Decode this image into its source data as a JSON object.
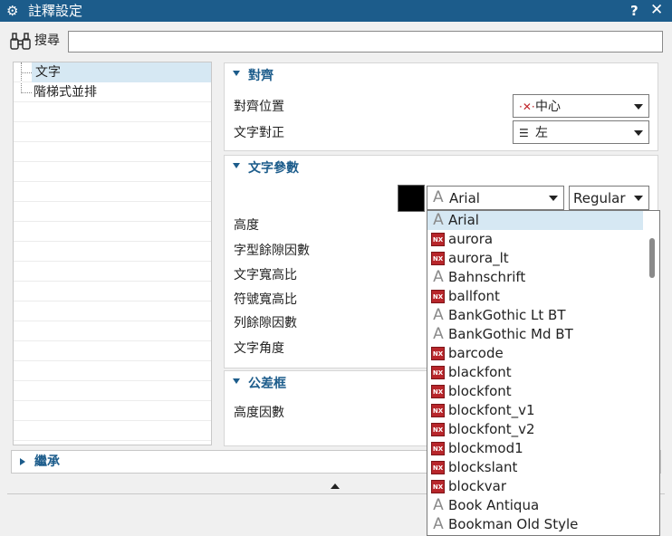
{
  "window": {
    "title": "註釋設定",
    "help_label": "?",
    "close_label": "✕"
  },
  "search": {
    "label": "搜尋",
    "value": ""
  },
  "tree": {
    "items": [
      {
        "label": "文字"
      },
      {
        "label": "階梯式並排"
      }
    ]
  },
  "alignment": {
    "title": "對齊",
    "position_label": "對齊位置",
    "position_value": "中心",
    "justify_label": "文字對正",
    "justify_value": "左"
  },
  "text_params": {
    "title": "文字參數",
    "font_value": "Arial",
    "style_value": "Regular",
    "fields": [
      "高度",
      "字型餘隙因數",
      "文字寬高比",
      "符號寬高比",
      "列餘隙因數",
      "文字角度"
    ]
  },
  "tolerance_frame": {
    "title": "公差框",
    "height_factor_label": "高度因數"
  },
  "inherit": {
    "label": "繼承"
  },
  "font_list": [
    {
      "name": "Arial",
      "icon": "truetype-icon"
    },
    {
      "name": "aurora",
      "icon": "nx-font-icon"
    },
    {
      "name": "aurora_lt",
      "icon": "nx-font-icon"
    },
    {
      "name": "Bahnschrift",
      "icon": "truetype-icon"
    },
    {
      "name": "ballfont",
      "icon": "nx-font-icon"
    },
    {
      "name": "BankGothic Lt BT",
      "icon": "truetype-icon"
    },
    {
      "name": "BankGothic Md BT",
      "icon": "truetype-icon"
    },
    {
      "name": "barcode",
      "icon": "nx-font-icon"
    },
    {
      "name": "blackfont",
      "icon": "nx-font-icon"
    },
    {
      "name": "blockfont",
      "icon": "nx-font-icon"
    },
    {
      "name": "blockfont_v1",
      "icon": "nx-font-icon"
    },
    {
      "name": "blockfont_v2",
      "icon": "nx-font-icon"
    },
    {
      "name": "blockmod1",
      "icon": "nx-font-icon"
    },
    {
      "name": "blockslant",
      "icon": "nx-font-icon"
    },
    {
      "name": "blockvar",
      "icon": "nx-font-icon"
    },
    {
      "name": "Book Antiqua",
      "icon": "truetype-icon"
    },
    {
      "name": "Bookman Old Style",
      "icon": "truetype-icon"
    }
  ],
  "font_list_selected": "Arial",
  "colors": {
    "titlebar": "#1c5c8b",
    "accent": "#1c5c8b",
    "selection": "#d6e8f3",
    "nx_icon": "#b8262b",
    "text_color_swatch": "#000000"
  }
}
